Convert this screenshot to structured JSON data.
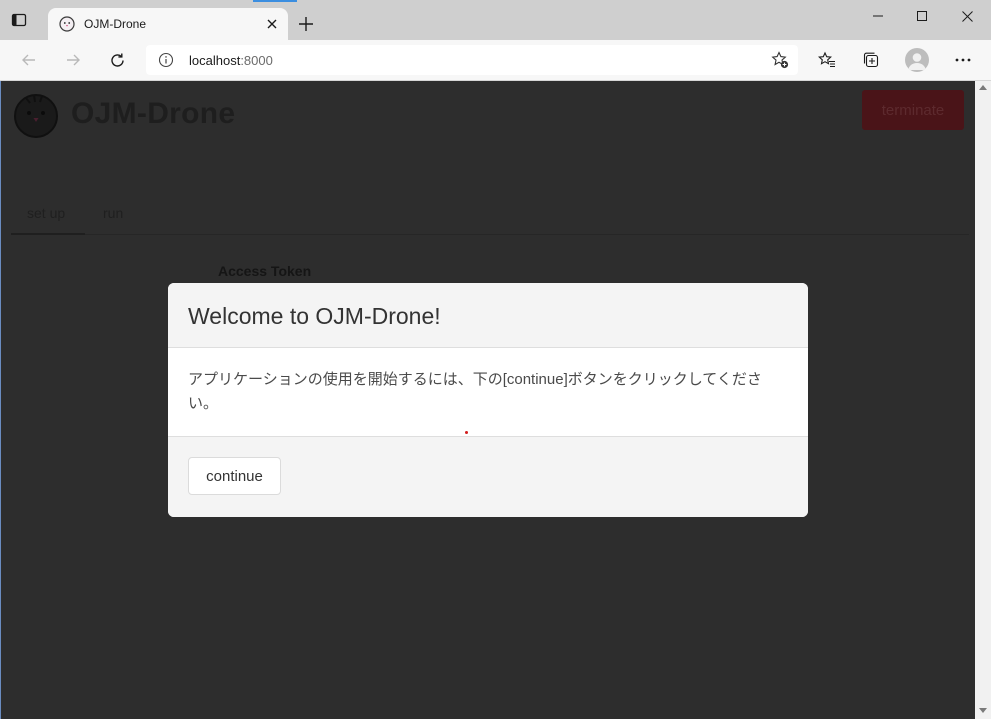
{
  "browser": {
    "tab_title": "OJM-Drone",
    "url_host": "localhost",
    "url_port": ":8000"
  },
  "app": {
    "title": "OJM-Drone",
    "terminate_label": "terminate",
    "tabs": [
      {
        "label": "set up",
        "active": true
      },
      {
        "label": "run",
        "active": false
      }
    ],
    "field_label": "Access Token"
  },
  "modal": {
    "title": "Welcome to OJM-Drone!",
    "body": "アプリケーションの使用を開始するには、下の[continue]ボタンをクリックしてください。",
    "continue_label": "continue"
  },
  "colors": {
    "backdrop": "#2d2d2d",
    "terminate_bg": "#4a1418",
    "accent_cursor": "#d21d1d"
  }
}
